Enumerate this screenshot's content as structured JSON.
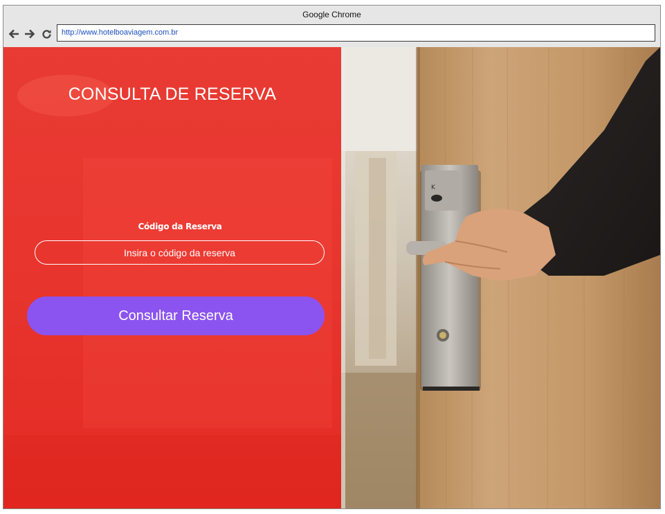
{
  "browser": {
    "title": "Google Chrome",
    "url": "http://www.hotelboaviagem.com.br",
    "nav": {
      "back_icon": "arrow-left-icon",
      "forward_icon": "arrow-right-icon",
      "reload_icon": "reload-icon"
    }
  },
  "page": {
    "title": "CONSULTA DE RESERVA",
    "form": {
      "code_label": "Código da Reserva",
      "code_placeholder": "Insira o código da reserva",
      "code_value": "",
      "submit_label": "Consultar Reserva"
    },
    "hero_image": "hand-opening-hotel-door-photo",
    "lock_label": "K"
  },
  "colors": {
    "panel_red": "#e8362f",
    "button_purple": "#8b54f0",
    "door_wood": "#c89b68"
  }
}
